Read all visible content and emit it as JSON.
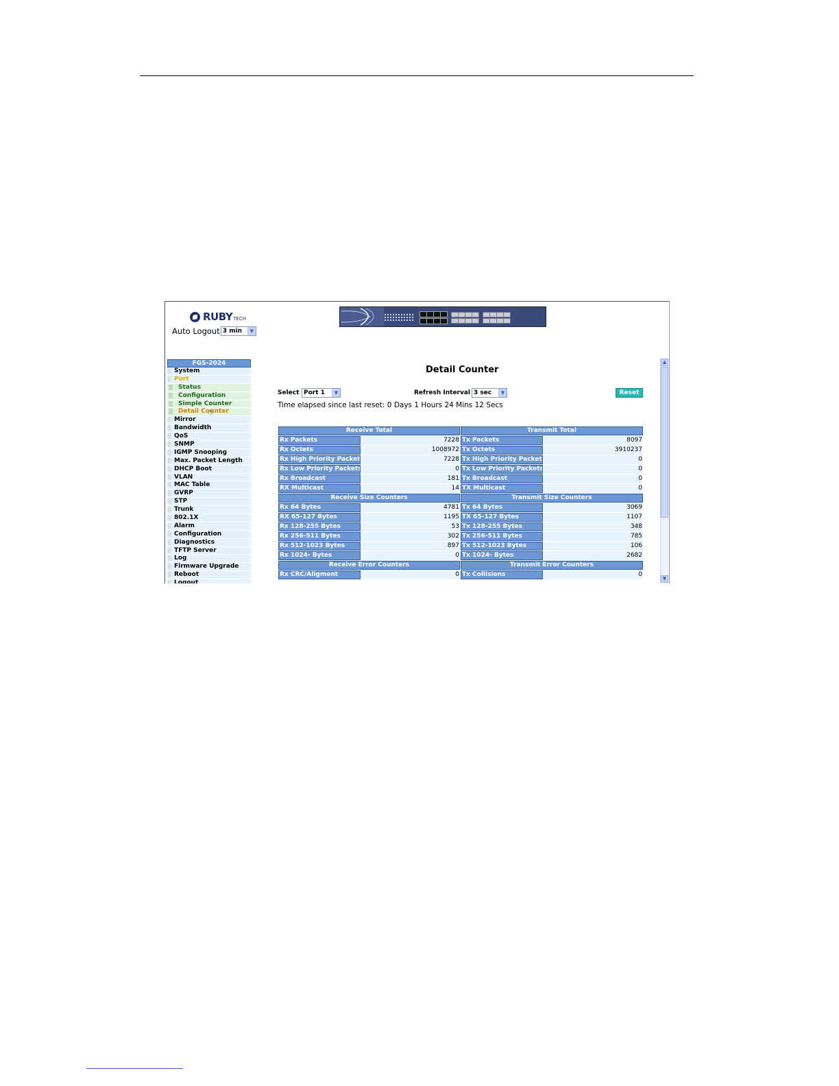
{
  "logo": {
    "name": "RUBY",
    "suffix": "TECH"
  },
  "auto_logout": {
    "label": "Auto Logout",
    "value": "3 min"
  },
  "sidebar": {
    "title": "FGS-2024",
    "items": [
      {
        "label": "System",
        "type": "top"
      },
      {
        "label": "Port",
        "type": "port"
      },
      {
        "label": "Status",
        "type": "sub"
      },
      {
        "label": "Configuration",
        "type": "sub"
      },
      {
        "label": "Simple Counter",
        "type": "sub"
      },
      {
        "label": "Detail Counter",
        "type": "active"
      },
      {
        "label": "Mirror",
        "type": "top"
      },
      {
        "label": "Bandwidth",
        "type": "top"
      },
      {
        "label": "QoS",
        "type": "top"
      },
      {
        "label": "SNMP",
        "type": "top"
      },
      {
        "label": "IGMP Snooping",
        "type": "top"
      },
      {
        "label": "Max. Packet Length",
        "type": "top"
      },
      {
        "label": "DHCP Boot",
        "type": "top"
      },
      {
        "label": "VLAN",
        "type": "top"
      },
      {
        "label": "MAC Table",
        "type": "top"
      },
      {
        "label": "GVRP",
        "type": "top"
      },
      {
        "label": "STP",
        "type": "top"
      },
      {
        "label": "Trunk",
        "type": "top"
      },
      {
        "label": "802.1X",
        "type": "top"
      },
      {
        "label": "Alarm",
        "type": "top"
      },
      {
        "label": "Configuration",
        "type": "top"
      },
      {
        "label": "Diagnostics",
        "type": "top"
      },
      {
        "label": "TFTP Server",
        "type": "top"
      },
      {
        "label": "Log",
        "type": "top"
      },
      {
        "label": "Firmware Upgrade",
        "type": "top"
      },
      {
        "label": "Reboot",
        "type": "top"
      },
      {
        "label": "Logout",
        "type": "top"
      }
    ]
  },
  "main": {
    "title": "Detail Counter",
    "select_label": "Select",
    "select_value": "Port 1",
    "refresh_label": "Refresh Interval",
    "refresh_value": "3 sec",
    "reset_label": "Reset",
    "elapsed": "Time elapsed since last reset: 0 Days 1 Hours 24 Mins 12 Secs"
  },
  "counters": [
    {
      "headers": [
        "Receive Total",
        "Transmit Total"
      ],
      "rows": [
        [
          "Rx Packets",
          "7228",
          "Tx Packets",
          "8097"
        ],
        [
          "Rx Octets",
          "1008972",
          "Tx Octets",
          "3910237"
        ],
        [
          "Rx High Priority Packets",
          "7228",
          "Tx High Priority Packets",
          "0"
        ],
        [
          "Rx Low Priority Packets",
          "0",
          "Tx Low Priority Packets",
          "0"
        ],
        [
          "Rx Broadcast",
          "181",
          "Tx Broadcast",
          "0"
        ],
        [
          "RX Multicast",
          "14",
          "TX Multicast",
          "0"
        ]
      ]
    },
    {
      "headers": [
        "Receive Size Counters",
        "Transmit Size Counters"
      ],
      "rows": [
        [
          "Rx 64 Bytes",
          "4781",
          "Tx 64 Bytes",
          "3069"
        ],
        [
          "RX 65-127 Bytes",
          "1195",
          "TX 65-127 Bytes",
          "1107"
        ],
        [
          "Rx 128-255 Bytes",
          "53",
          "Tx 128-255 Bytes",
          "348"
        ],
        [
          "Rx 256-511 Bytes",
          "302",
          "Tx 256-511 Bytes",
          "785"
        ],
        [
          "Rx 512-1023 Bytes",
          "897",
          "Tx 512-1023 Bytes",
          "106"
        ],
        [
          "Rx 1024- Bytes",
          "0",
          "Tx 1024- Bytes",
          "2682"
        ]
      ]
    },
    {
      "headers": [
        "Receive Error Counters",
        "Transmit Error Counters"
      ],
      "rows": [
        [
          "Rx CRC/Aligment",
          "0",
          "Tx Collisions",
          "0"
        ]
      ]
    }
  ]
}
